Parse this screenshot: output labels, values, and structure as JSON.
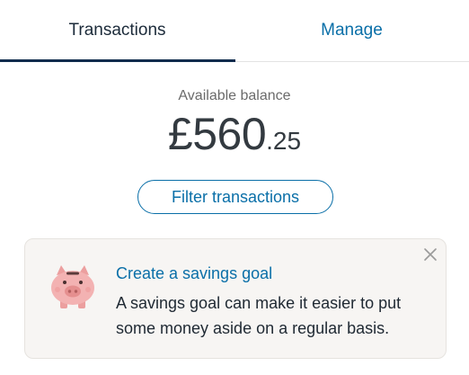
{
  "tabs": [
    {
      "label": "Transactions",
      "active": true
    },
    {
      "label": "Manage",
      "active": false
    }
  ],
  "balance": {
    "label": "Available balance",
    "amount_main": "£560",
    "amount_pence": ".25"
  },
  "filter_button": {
    "label": "Filter transactions"
  },
  "savings_card": {
    "title": "Create a savings goal",
    "body": "A savings goal can make it easier to put some money aside on a regular basis.",
    "icons": {
      "illustration": "piggy-bank-icon",
      "close": "close-icon"
    }
  },
  "colors": {
    "accent": "#0a6fa8",
    "tab_underline": "#0f2c4d",
    "card_bg": "#f7f5f3",
    "pig": "#f3b2b2"
  }
}
